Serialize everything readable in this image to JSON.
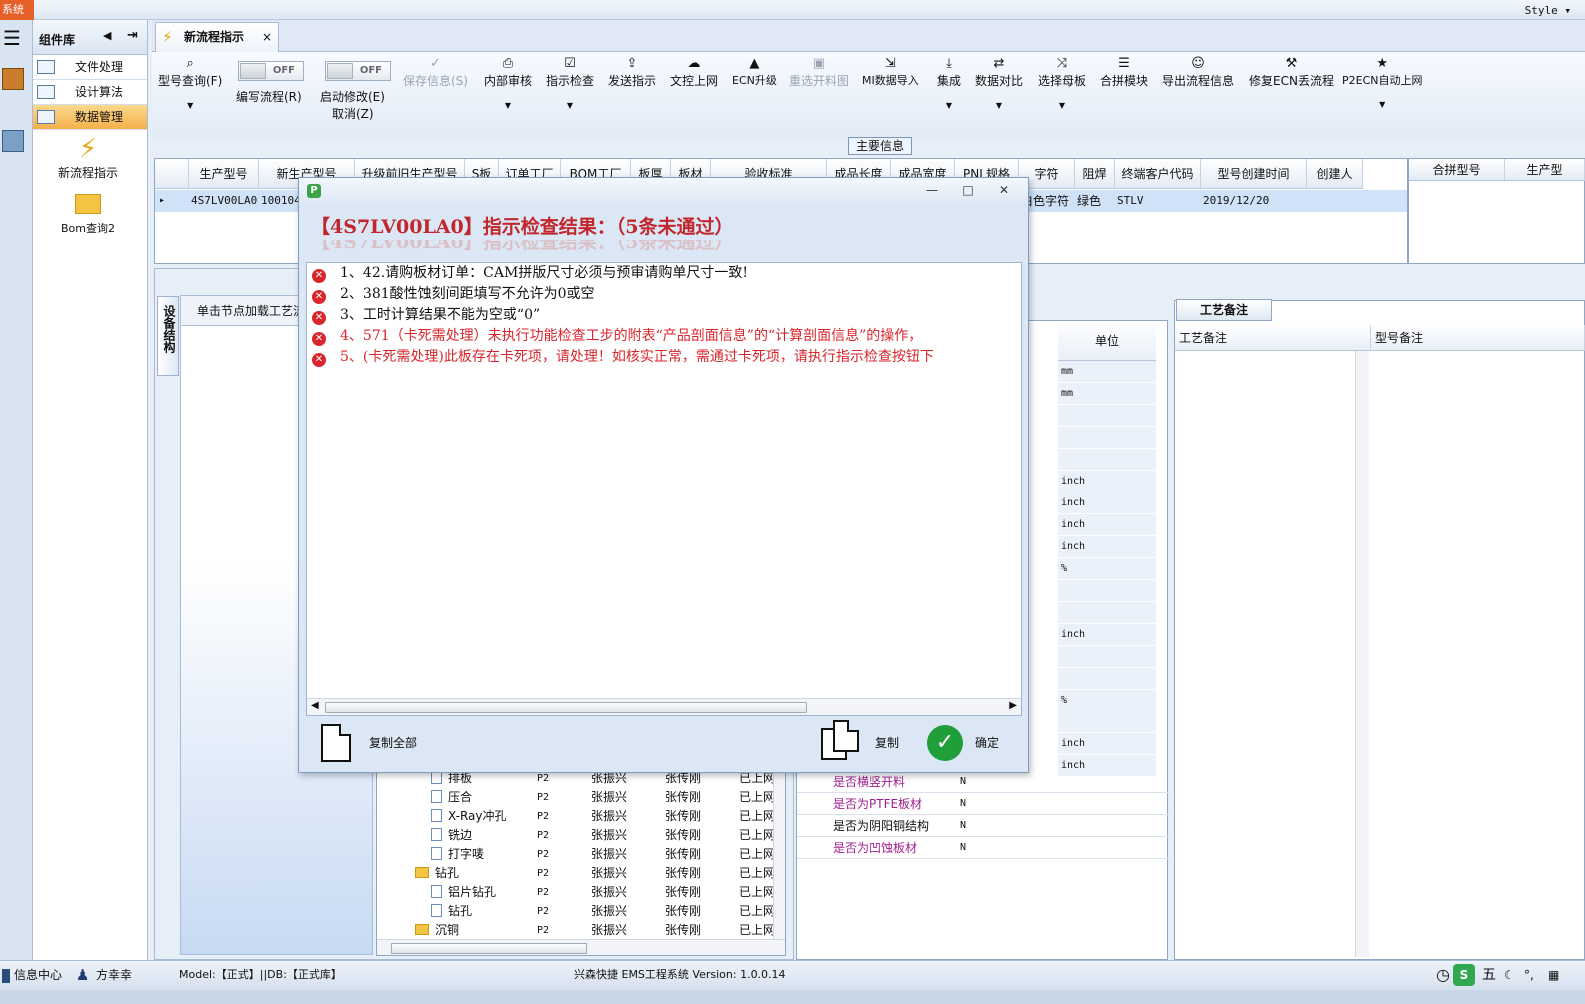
{
  "window": {
    "app_badge": "系统",
    "style_menu": "Style ▾"
  },
  "sidebar": {
    "title": "组件库",
    "items": [
      {
        "label": "文件处理",
        "active": false
      },
      {
        "label": "设计算法",
        "active": false
      },
      {
        "label": "数据管理",
        "active": true
      }
    ],
    "launchers": [
      {
        "label": "新流程指示",
        "icon": "lightning-icon"
      },
      {
        "label": "Bom查询2",
        "icon": "folder-open-icon"
      }
    ]
  },
  "tab": {
    "label": "新流程指示",
    "close": "×"
  },
  "toolbar": {
    "type_query": "型号查询(F)",
    "edit_flow": "编写流程(R)",
    "edit_flow_state": "OFF",
    "start_edit": "启动修改(E)",
    "start_edit_sub": "取消(Z)",
    "start_edit_state": "OFF",
    "save_info": "保存信息(S)",
    "internal_review": "内部审核",
    "instruction_check": "指示检查",
    "send_instruction": "发送指示",
    "upload_doc": "文控上网",
    "ecn_upgrade": "ECN升级",
    "reselect_cut": "重选开料图",
    "mi_import": "MI数据导入",
    "integrate": "集成",
    "data_compare": "数据对比",
    "select_master": "选择母板",
    "merge_module": "合拼模块",
    "export_flow": "导出流程信息",
    "repair_ecn": "修复ECN丢流程",
    "p2ecn": "P2ECN自动上网"
  },
  "main_info": {
    "section_title": "主要信息",
    "columns": [
      "生产型号",
      "新生产型号",
      "升级前旧生产型号",
      "S板",
      "订单工厂",
      "BOM工厂",
      "板厚",
      "板材",
      "验收标准",
      "成品长度",
      "成品宽度",
      "PNL规格",
      "字符",
      "阻焊",
      "终端客户代码",
      "型号创建时间",
      "创建人"
    ],
    "row": {
      "marker": "▸",
      "model": "4S7LV00LA0",
      "new_model": "100104",
      "char_color": "白色字符",
      "mask": "绿色",
      "customer": "STLV",
      "created": "2019/12/20"
    },
    "side_columns": [
      "合拼型号",
      "生产型"
    ]
  },
  "tree_panel": {
    "vertical_tab": "设备结构",
    "header": "单击节点加载工艺流程",
    "rows": [
      {
        "name": "排板",
        "kind": "file",
        "c1": "P2",
        "c2": "张振兴",
        "c3": "张传刚",
        "c4": "已上网"
      },
      {
        "name": "压合",
        "kind": "file",
        "c1": "P2",
        "c2": "张振兴",
        "c3": "张传刚",
        "c4": "已上网"
      },
      {
        "name": "X-Ray冲孔",
        "kind": "file",
        "c1": "P2",
        "c2": "张振兴",
        "c3": "张传刚",
        "c4": "已上网"
      },
      {
        "name": "铣边",
        "kind": "file",
        "c1": "P2",
        "c2": "张振兴",
        "c3": "张传刚",
        "c4": "已上网"
      },
      {
        "name": "打字唛",
        "kind": "file",
        "c1": "P2",
        "c2": "张振兴",
        "c3": "张传刚",
        "c4": "已上网"
      },
      {
        "name": "钻孔",
        "kind": "folder",
        "c1": "P2",
        "c2": "张振兴",
        "c3": "张传刚",
        "c4": "已上网"
      },
      {
        "name": "铝片钻孔",
        "kind": "file",
        "c1": "P2",
        "c2": "张振兴",
        "c3": "张传刚",
        "c4": "已上网"
      },
      {
        "name": "钻孔",
        "kind": "file",
        "c1": "P2",
        "c2": "张振兴",
        "c3": "张传刚",
        "c4": "已上网"
      },
      {
        "name": "沉铜",
        "kind": "folder",
        "c1": "P2",
        "c2": "张振兴",
        "c3": "张传刚",
        "c4": "已上网"
      }
    ]
  },
  "properties": {
    "unit_header": "单位",
    "units": [
      "mm",
      "mm",
      "",
      "",
      "",
      "inch",
      "inch",
      "inch",
      "inch",
      "%",
      "",
      "",
      "inch",
      "",
      "",
      "%",
      "",
      "inch",
      "inch"
    ],
    "rows": [
      {
        "key": "是否横竖开料",
        "value": "N",
        "color": "#a0208f"
      },
      {
        "key": "是否为PTFE板材",
        "value": "N",
        "color": "#a0208f"
      },
      {
        "key": "是否为阴阳铜结构",
        "value": "N",
        "color": "#111111"
      },
      {
        "key": "是否为凹蚀板材",
        "value": "N",
        "color": "#a0208f"
      }
    ]
  },
  "notes": {
    "tab": "工艺备注",
    "col1": "工艺备注",
    "col2": "型号备注"
  },
  "statusbar": {
    "info_center": "信息中心",
    "user": "方幸幸",
    "model_db": "Model:【正式】||DB:【正式库】",
    "version": "兴森快捷 EMS工程系统 Version: 1.0.0.14",
    "ime": "五"
  },
  "dialog": {
    "title_logo": "P",
    "minimize": "—",
    "maximize": "□",
    "close": "✕",
    "heading": "【4S7LV00LA0】指示检查结果：（5条未通过）",
    "messages": [
      {
        "text": "1、42.请购板材订单：CAM拼版尺寸必须与预审请购单尺寸一致!",
        "severity": "black"
      },
      {
        "text": "2、381酸性蚀刻间距填写不允许为0或空",
        "severity": "black"
      },
      {
        "text": "3、工时计算结果不能为空或“0”",
        "severity": "black"
      },
      {
        "text": "4、571（卡死需处理）未执行功能检查工步的附表“产品剖面信息”的“计算剖面信息”的操作，",
        "severity": "red"
      },
      {
        "text": "5、(卡死需处理)此板存在卡死项，请处理！如核实正常，需通过卡死项，请执行指示检查按钮下",
        "severity": "red"
      }
    ],
    "copy_all": "复制全部",
    "copy": "复制",
    "ok": "确定"
  },
  "colors": {
    "accent_red": "#d9262c",
    "selected_row": "#cfe2f8",
    "active_menu": "#f5b14b"
  }
}
